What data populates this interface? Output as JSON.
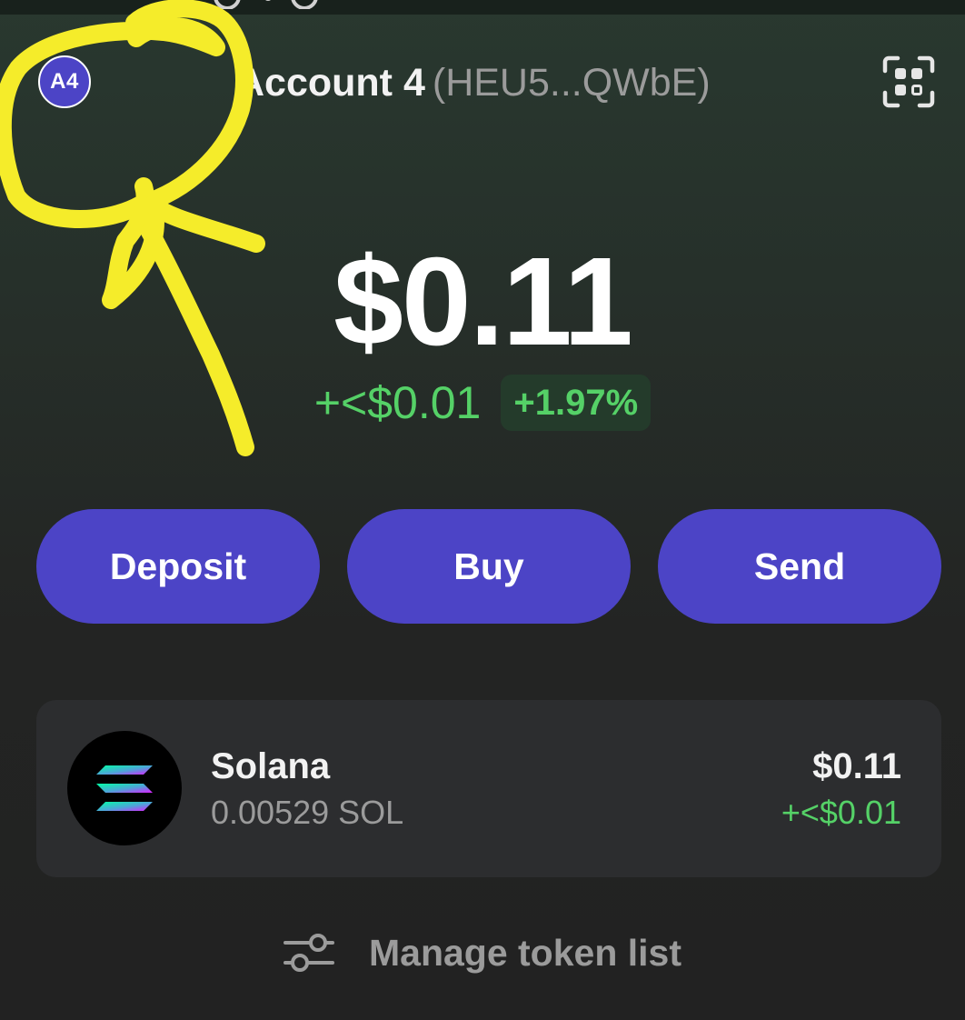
{
  "header": {
    "avatar_initials": "A4",
    "account_name": "Account 4",
    "account_address": "(HEU5...QWbE)",
    "scan_icon": "qr-scan-icon"
  },
  "balance": {
    "total": "$0.11",
    "change_amount": "+<$0.01",
    "change_percent": "+1.97%"
  },
  "actions": {
    "deposit_label": "Deposit",
    "buy_label": "Buy",
    "send_label": "Send"
  },
  "tokens": [
    {
      "name": "Solana",
      "amount": "0.00529 SOL",
      "value": "$0.11",
      "change": "+<$0.01",
      "icon": "solana-logo-icon"
    }
  ],
  "manage": {
    "label": "Manage token list",
    "icon": "sliders-icon"
  },
  "colors": {
    "accent": "#4c44c6",
    "positive": "#55d167",
    "annotation": "#f5ec2a",
    "card": "#2c2d2f",
    "muted_text": "#9b9b9b"
  }
}
